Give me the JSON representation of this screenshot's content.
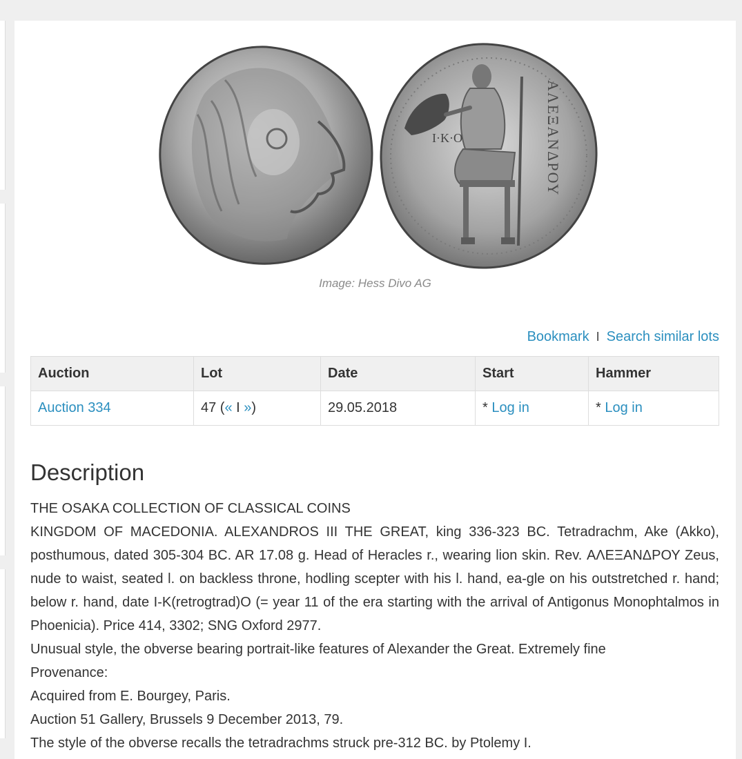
{
  "image": {
    "caption": "Image: Hess Divo AG",
    "reverse_legend": "ΑΛΕΞΑΝΔΡΟΥ"
  },
  "actions": {
    "bookmark": "Bookmark",
    "separator": "I",
    "search_similar": "Search similar lots"
  },
  "table": {
    "headers": [
      "Auction",
      "Lot",
      "Date",
      "Start",
      "Hammer"
    ],
    "row": {
      "auction": "Auction 334",
      "lot_number": "47 (",
      "prev": "«",
      "lot_sep": " I ",
      "next": "»",
      "lot_close": ")",
      "date": "29.05.2018",
      "start_prefix": "* ",
      "start_link": "Log in",
      "hammer_prefix": "* ",
      "hammer_link": "Log in"
    }
  },
  "description": {
    "title": "Description",
    "collection": "THE OSAKA COLLECTION OF CLASSICAL COINS",
    "main": "KINGDOM OF MACEDONIA. ALEXANDROS III THE GREAT, king 336-323 BC. Tetradrachm, Ake (Akko), posthumous, dated 305-304 BC. AR 17.08 g. Head of Heracles r., wearing lion skin. Rev. ΑΛΕΞΑΝΔΡΟΥ Zeus, nude to waist, seated l. on backless throne, hodling scepter with his l. hand, ea-gle on his outstretched r. hand; below r. hand, date I-K(retrogtrad)O (= year 11 of the era starting with the arrival of Antigonus Monophtalmos in Phoenicia). Price 414, 3302; SNG Oxford 2977.",
    "style": "Unusual style, the obverse bearing portrait-like features of Alexander the Great. Extremely fine",
    "provenance_label": "Provenance:",
    "provenance_1": "Acquired from E. Bourgey, Paris.",
    "provenance_2": "Auction 51 Gallery, Brussels 9 December 2013, 79.",
    "note": "The style of the obverse recalls the tetradrachms struck pre-312 BC. by Ptolemy I."
  },
  "colors": {
    "link": "#2b8fbf",
    "text": "#333333",
    "table_header_bg": "#f0f0f0",
    "page_bg": "#efefef"
  }
}
